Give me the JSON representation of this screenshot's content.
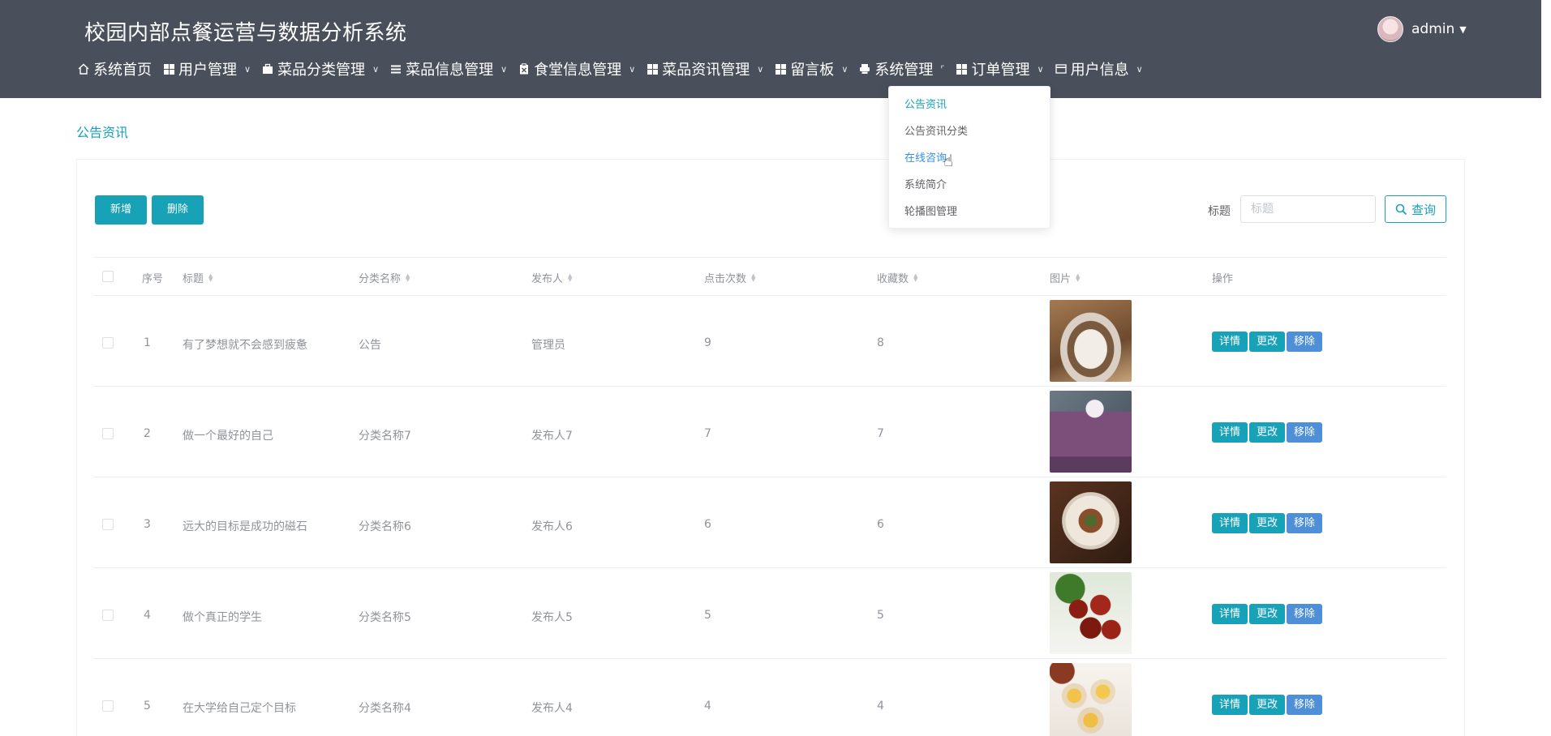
{
  "header": {
    "title": "校园内部点餐运营与数据分析系统",
    "user": "admin"
  },
  "nav": [
    {
      "label": "系统首页",
      "icon": "home-icon"
    },
    {
      "label": "用户管理",
      "icon": "grid-icon"
    },
    {
      "label": "菜品分类管理",
      "icon": "briefcase-icon"
    },
    {
      "label": "菜品信息管理",
      "icon": "list-icon"
    },
    {
      "label": "食堂信息管理",
      "icon": "clipboard-icon"
    },
    {
      "label": "菜品资讯管理",
      "icon": "grid-icon"
    },
    {
      "label": "留言板",
      "icon": "grid-icon"
    },
    {
      "label": "系统管理",
      "icon": "printer-icon"
    },
    {
      "label": "订单管理",
      "icon": "grid-icon"
    },
    {
      "label": "用户信息",
      "icon": "card-icon"
    }
  ],
  "dropdown": [
    "公告资讯",
    "公告资讯分类",
    "在线咨询",
    "系统简介",
    "轮播图管理"
  ],
  "breadcrumb": "公告资讯",
  "toolbar": {
    "add_label": "新增",
    "delete_label": "删除",
    "search_label": "标题",
    "search_placeholder": "标题",
    "query_label": "查询"
  },
  "columns": [
    "序号",
    "标题",
    "分类名称",
    "发布人",
    "点击次数",
    "收藏数",
    "图片",
    "操作"
  ],
  "rows": [
    {
      "index": "1",
      "title": "有了梦想就不会感到疲惫",
      "category": "公告",
      "publisher": "管理员",
      "clicks": "9",
      "favorites": "8",
      "image": "food-bowl-image"
    },
    {
      "index": "2",
      "title": "做一个最好的自己",
      "category": "分类名称7",
      "publisher": "发布人7",
      "clicks": "7",
      "favorites": "7",
      "image": "smoothie-image"
    },
    {
      "index": "3",
      "title": "远大的目标是成功的磁石",
      "category": "分类名称6",
      "publisher": "发布人6",
      "clicks": "6",
      "favorites": "6",
      "image": "plated-dish-image"
    },
    {
      "index": "4",
      "title": "做个真正的学生",
      "category": "分类名称5",
      "publisher": "发布人5",
      "clicks": "5",
      "favorites": "5",
      "image": "jujube-image"
    },
    {
      "index": "5",
      "title": "在大学给自己定个目标",
      "category": "分类名称4",
      "publisher": "发布人4",
      "clicks": "4",
      "favorites": "4",
      "image": "egg-tarts-image"
    }
  ],
  "row_actions": {
    "detail": "详情",
    "edit": "更改",
    "remove": "移除"
  },
  "colors": {
    "header_bg": "#4a505b",
    "accent": "#17a2b8",
    "remove": "#4e8fd8"
  }
}
